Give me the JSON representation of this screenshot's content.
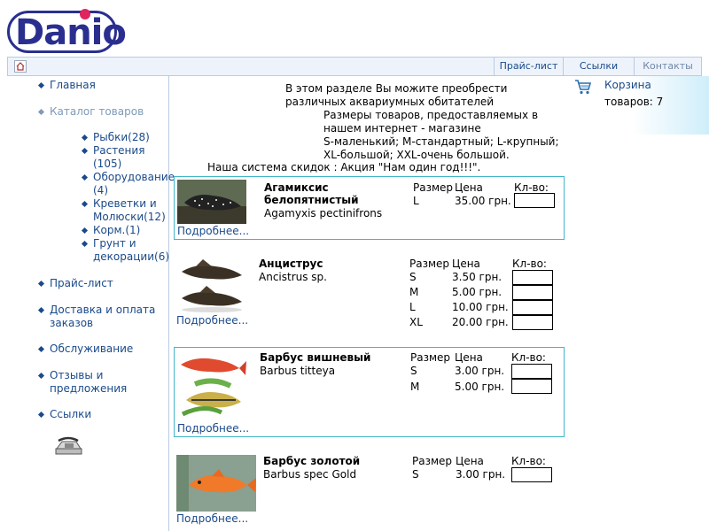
{
  "logo": {
    "text": "Danio"
  },
  "topnav": {
    "home_icon": "home-icon",
    "links": [
      "Прайс-лист",
      "Ссылки",
      "Контакты"
    ]
  },
  "menu": {
    "items": [
      "Главная",
      "Каталог товаров",
      "Прайс-лист",
      "Доставка и оплата заказов",
      "Обслуживание",
      "Отзывы и предложения",
      "Ссылки"
    ],
    "catalog_sub": [
      "Рыбки(28)",
      "Растения (105)",
      "Оборудование (4)",
      "Креветки и Молюски(12)",
      "Корм.(1)",
      "Грунт и декорации(6)"
    ],
    "phone_icon": "phone-icon"
  },
  "cart": {
    "icon": "cart-icon",
    "label": "Корзина",
    "count_text": "товаров: 7"
  },
  "intro": {
    "line1": "В этом разделе Вы можите преобрести",
    "line2": "различных аквариумных обитателей",
    "line3": "Размеры товаров, предоставляемых в",
    "line4": "нашем интернет - магазине",
    "line5": "S-маленький; M-стандартный; L-крупный;",
    "line6": "XL-большой; XXL-очень большой.",
    "line7": "Наша система скидок : Акция \"Нам один год!!!\"."
  },
  "columns": {
    "size": "Размер",
    "price": "Цена",
    "qty": "Кл-во:"
  },
  "products": [
    {
      "name_line1": "Агамиксис",
      "name_line2": "белопятнистый",
      "latin": "Agamyxis pectinifrons",
      "more": "Подробнее...",
      "rows": [
        {
          "size": "L",
          "price": "35.00 грн."
        }
      ]
    },
    {
      "name_line1": "Анциструс",
      "name_line2": "",
      "latin": "Ancistrus sp.",
      "more": "Подробнее...",
      "rows": [
        {
          "size": "S",
          "price": "3.50 грн."
        },
        {
          "size": "M",
          "price": "5.00 грн."
        },
        {
          "size": "L",
          "price": "10.00 грн."
        },
        {
          "size": "XL",
          "price": "20.00 грн."
        }
      ]
    },
    {
      "name_line1": "Барбус вишневый",
      "name_line2": "",
      "latin": "Barbus titteya",
      "more": "Подробнее...",
      "rows": [
        {
          "size": "S",
          "price": "3.00 грн."
        },
        {
          "size": "M",
          "price": "5.00 грн."
        }
      ]
    },
    {
      "name_line1": "Барбус золотой",
      "name_line2": "",
      "latin": "Barbus spec Gold",
      "more": "Подробнее...",
      "rows": [
        {
          "size": "S",
          "price": "3.00 грн."
        }
      ]
    }
  ],
  "colors": {
    "accent": "#1a4a8a",
    "border": "#41b6c8",
    "nav_bg": "#eef3fb"
  }
}
